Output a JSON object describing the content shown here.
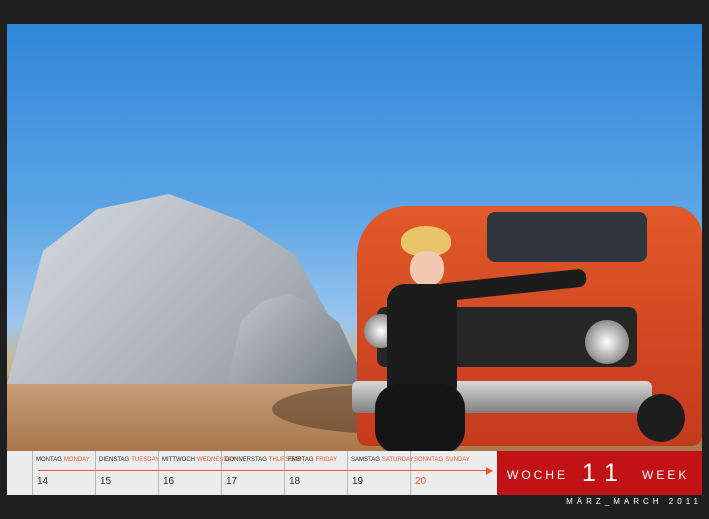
{
  "calendar": {
    "days": [
      {
        "german": "MONTAG",
        "english": "MONDAY",
        "number": "14"
      },
      {
        "german": "DIENSTAG",
        "english": "TUESDAY",
        "number": "15"
      },
      {
        "german": "MITTWOCH",
        "english": "WEDNESDAY",
        "number": "16"
      },
      {
        "german": "DONNERSTAG",
        "english": "THURSDAY",
        "number": "17"
      },
      {
        "german": "FREITAG",
        "english": "FRIDAY",
        "number": "18"
      },
      {
        "german": "SAMSTAG",
        "english": "SATURDAY",
        "number": "19"
      },
      {
        "german": "SONNTAG",
        "english": "SUNDAY",
        "number": "20"
      }
    ],
    "week": {
      "german": "WOCHE",
      "number": "11",
      "english": "WEEK"
    },
    "month": "MÄRZ_MARCH 2011"
  },
  "colors": {
    "accent": "#ef5a3a",
    "week_box": "#c11216",
    "frame": "#1f1f1f"
  }
}
